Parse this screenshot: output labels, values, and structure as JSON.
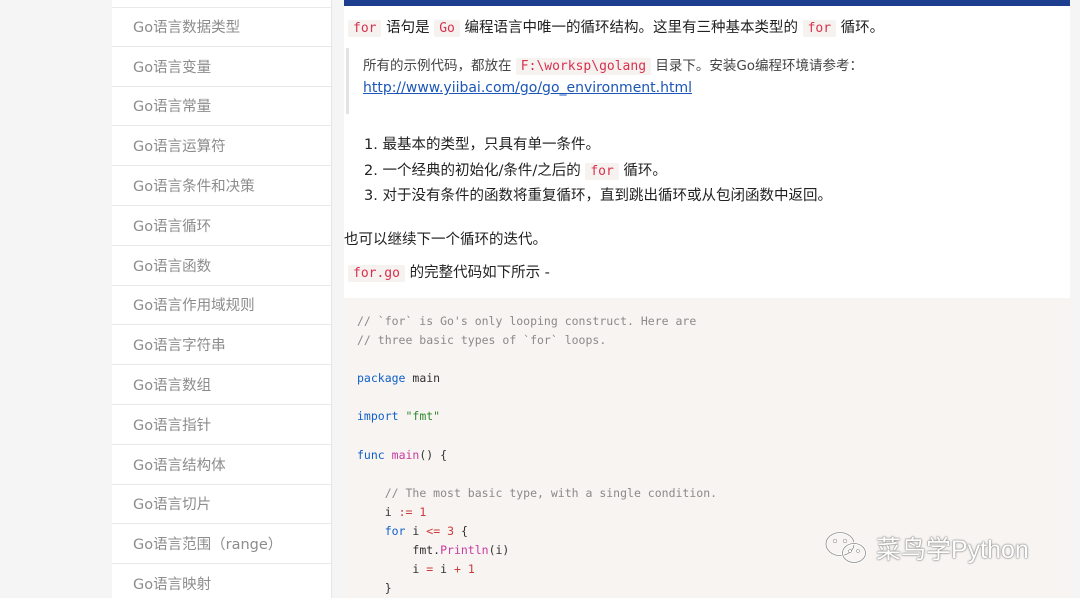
{
  "sidebar": {
    "items": [
      "Go语言数据类型",
      "Go语言变量",
      "Go语言常量",
      "Go语言运算符",
      "Go语言条件和决策",
      "Go语言循环",
      "Go语言函数",
      "Go语言作用域规则",
      "Go语言字符串",
      "Go语言数组",
      "Go语言指针",
      "Go语言结构体",
      "Go语言切片",
      "Go语言范围（range）",
      "Go语言映射"
    ]
  },
  "content": {
    "intro": {
      "kw_for": "for",
      "t1": "语句是",
      "kw_go": "Go",
      "t2": "编程语言中唯一的循环结构。这里有三种基本类型的",
      "kw_for2": "for",
      "t3": "循环。"
    },
    "note": {
      "prefix": "所有的示例代码，都放在",
      "path": "F:\\worksp\\golang",
      "suffix": "目录下。安装Go编程环境请参考：",
      "link": "http://www.yiibai.com/go/go_environment.html"
    },
    "list": {
      "item1": "1. 最基本的类型，只具有单一条件。",
      "item2_prefix": "2. 一个经典的初始化/条件/之后的",
      "item2_code": "for",
      "item2_suffix": "循环。",
      "item3": "3. 对于没有条件的函数将重复循环，直到跳出循环或从包闭函数中返回。"
    },
    "p2": "也可以继续下一个循环的迭代。",
    "p3_code": "for.go",
    "p3_text": "的完整代码如下所示 -"
  },
  "code": {
    "l1": "// `for` is Go's only looping construct. Here are",
    "l2": "// three basic types of `for` loops.",
    "l4_kw": "package",
    "l4_rest": " main",
    "l6_kw": "import",
    "l6_str": "\"fmt\"",
    "l8_kw": "func",
    "l8_fn": "main",
    "l8_rest": "() {",
    "l10": "// The most basic type, with a single condition.",
    "l11_var": "i",
    "l11_op": ":=",
    "l11_num": "1",
    "l12_kw": "for",
    "l12_var": "i",
    "l12_op": "<=",
    "l12_num": "3",
    "l12_brace": "{",
    "l13_pkg": "fmt",
    "l13_fn": "Println",
    "l13_arg": "(i)",
    "l14_var": "i",
    "l14_eq": "=",
    "l14_expr": "i",
    "l14_plus": "+",
    "l14_num": "1",
    "l15": "}"
  },
  "watermark": {
    "text": "菜鸟学Python"
  },
  "colors": {
    "topbar": "#1d3d8f",
    "link": "#1b56b8",
    "inline_code": "#d9304f"
  }
}
